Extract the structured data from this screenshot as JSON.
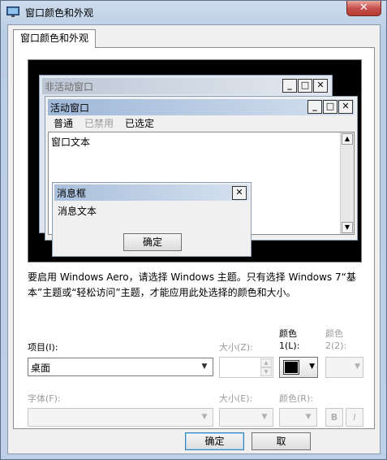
{
  "window": {
    "title": "窗口颜色和外观",
    "close_glyph": "✕"
  },
  "tab": {
    "label": "窗口颜色和外观"
  },
  "preview": {
    "inactive_title": "非活动窗口",
    "active_title": "活动窗口",
    "menu": {
      "normal": "普通",
      "disabled": "已禁用",
      "selected": "已选定"
    },
    "window_text": "窗口文本",
    "message_box": {
      "title": "消息框",
      "text": "消息文本",
      "ok": "确定"
    },
    "caption_buttons": {
      "minimize": "_",
      "maximize": "□",
      "close": "✕"
    },
    "scroll": {
      "up": "▲",
      "down": "▼"
    }
  },
  "info_text": "要启用 Windows Aero，请选择 Windows 主题。只有选择 Windows 7“基本”主题或“轻松访问”主题，才能应用此处选择的颜色和大小。",
  "controls": {
    "item": {
      "label": "项目(I):",
      "value": "桌面"
    },
    "item_size": {
      "label": "大小(Z):"
    },
    "color1": {
      "label_line1": "颜色",
      "label_line2": "1(L):",
      "swatch_color": "#000000"
    },
    "color2": {
      "label_line1": "颜色",
      "label_line2": "2(2):"
    },
    "font": {
      "label": "字体(F):"
    },
    "font_size": {
      "label": "大小(E):"
    },
    "font_color": {
      "label": "颜色(R):"
    },
    "bold": "B",
    "italic": "I",
    "drop_glyph": "▼"
  },
  "buttons": {
    "ok": "确定",
    "cancel": "取"
  }
}
